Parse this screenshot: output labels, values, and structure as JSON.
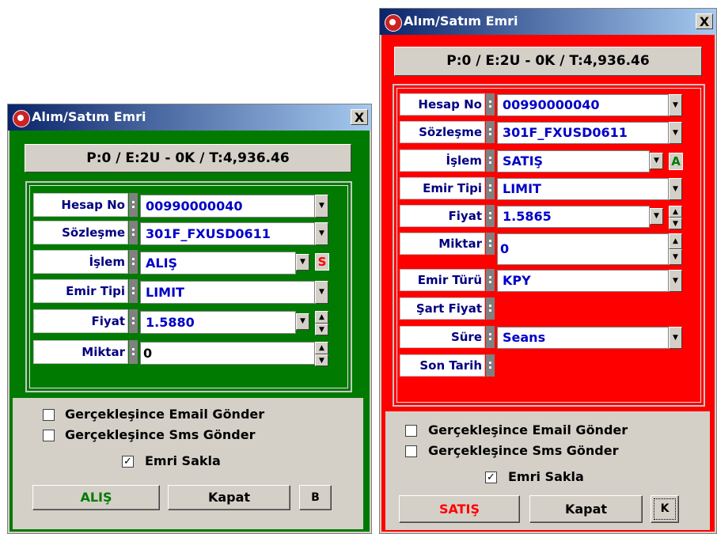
{
  "colors": {
    "buy": "#007a00",
    "sell": "#ff0000",
    "title_start": "#0a246a",
    "title_end": "#a6caf0"
  },
  "left": {
    "title": "Alım/Satım Emri",
    "close": "X",
    "position": "P:0  / E:2U - 0K / T:4,936.46",
    "labels": {
      "account": "Hesap No",
      "contract": "Sözleşme",
      "action": "İşlem",
      "order_type": "Emir Tipi",
      "price": "Fiyat",
      "quantity": "Miktar"
    },
    "values": {
      "account": "00990000040",
      "contract": "301F_FXUSD0611",
      "action": "ALIŞ",
      "order_type": "LIMIT",
      "price": "1.5880",
      "quantity": "0"
    },
    "switch": "S",
    "checkboxes": [
      {
        "label": "Gerçekleşince Email Gönder",
        "checked": false
      },
      {
        "label": "Gerçekleşince Sms Gönder",
        "checked": false
      },
      {
        "label": "Emri Sakla",
        "checked": true
      }
    ],
    "buttons": {
      "submit": "ALIŞ",
      "close": "Kapat",
      "side": "B"
    }
  },
  "right": {
    "title": "Alım/Satım Emri",
    "close": "X",
    "position": "P:0  / E:2U - 0K / T:4,936.46",
    "labels": {
      "account": "Hesap No",
      "contract": "Sözleşme",
      "action": "İşlem",
      "order_type": "Emir Tipi",
      "price": "Fiyat",
      "quantity": "Miktar",
      "order_kind": "Emir Türü",
      "cond_price": "Şart Fiyat",
      "duration": "Süre",
      "end_date": "Son Tarih"
    },
    "values": {
      "account": "00990000040",
      "contract": "301F_FXUSD0611",
      "action": "SATIŞ",
      "order_type": "LIMIT",
      "price": "1.5865",
      "quantity": "0",
      "order_kind": "KPY",
      "duration": "Seans"
    },
    "switch": "A",
    "checkboxes": [
      {
        "label": "Gerçekleşince Email Gönder",
        "checked": false
      },
      {
        "label": "Gerçekleşince Sms Gönder",
        "checked": false
      },
      {
        "label": "Emri Sakla",
        "checked": true
      }
    ],
    "buttons": {
      "submit": "SATIŞ",
      "close": "Kapat",
      "side": "K"
    }
  }
}
